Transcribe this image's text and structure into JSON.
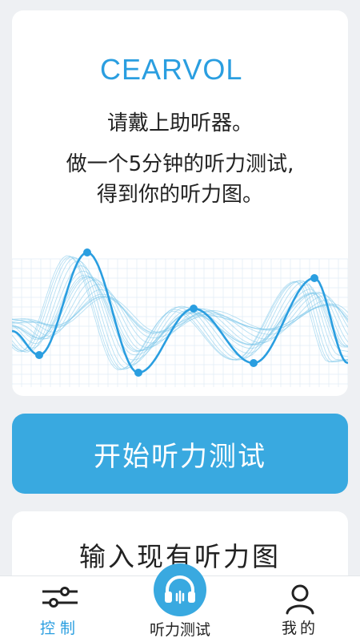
{
  "brand": {
    "name": "CEARVOL",
    "accent": "#39a9e0"
  },
  "intro": {
    "line1": "请戴上助听器。",
    "line2a": "做一个5分钟的听力测试,",
    "line2b": "得到你的听力图。"
  },
  "actions": {
    "start_test": "开始听力测试",
    "import_audiogram": "输入现有听力图"
  },
  "tabbar": {
    "tabs": [
      {
        "label": "控制",
        "icon": "sliders-icon",
        "active": true
      },
      {
        "label": "听力测试",
        "icon": "headphones-icon",
        "active": false
      },
      {
        "label": "我的",
        "icon": "user-icon",
        "active": false
      }
    ]
  }
}
